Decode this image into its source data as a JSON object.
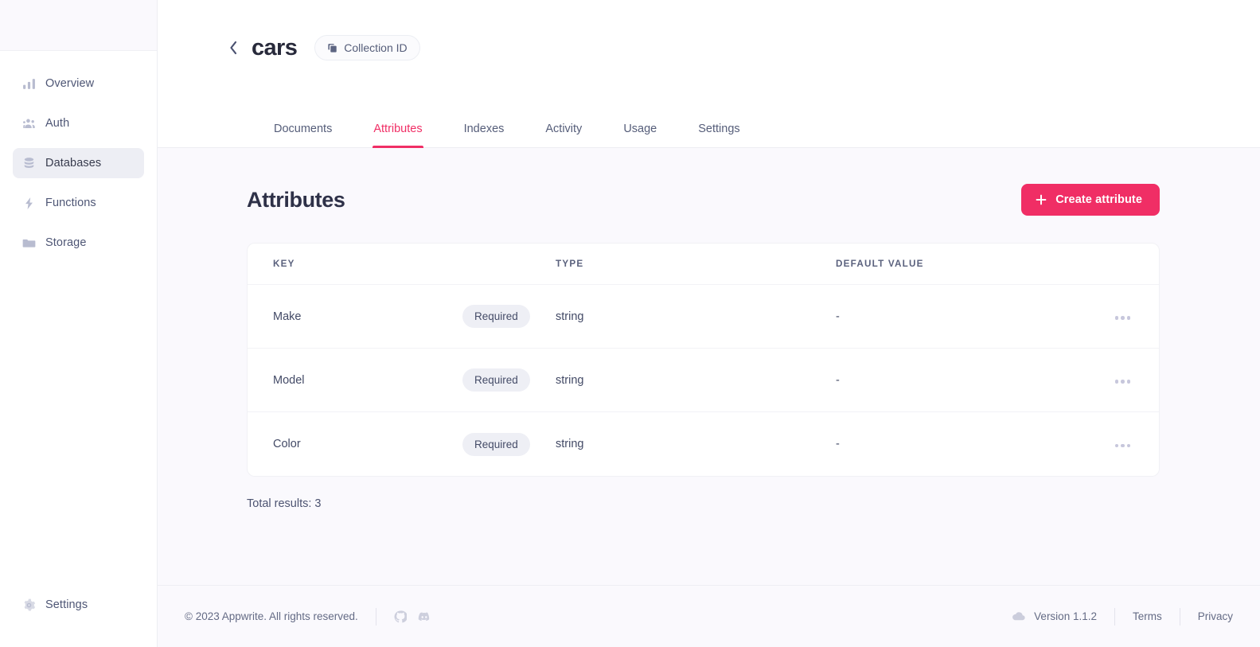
{
  "sidebar": {
    "items": [
      {
        "label": "Overview",
        "icon": "bar-chart-icon",
        "active": false
      },
      {
        "label": "Auth",
        "icon": "users-icon",
        "active": false
      },
      {
        "label": "Databases",
        "icon": "database-icon",
        "active": true
      },
      {
        "label": "Functions",
        "icon": "lightning-bolt-icon",
        "active": false
      },
      {
        "label": "Storage",
        "icon": "folder-icon",
        "active": false
      }
    ],
    "bottom": {
      "label": "Settings",
      "icon": "gear-icon"
    }
  },
  "header": {
    "back_icon": "chevron-left-icon",
    "collection_name": "cars",
    "collection_id_pill": {
      "label": "Collection ID",
      "icon": "copy-icon"
    },
    "tabs": [
      {
        "label": "Documents",
        "active": false
      },
      {
        "label": "Attributes",
        "active": true
      },
      {
        "label": "Indexes",
        "active": false
      },
      {
        "label": "Activity",
        "active": false
      },
      {
        "label": "Usage",
        "active": false
      },
      {
        "label": "Settings",
        "active": false
      }
    ]
  },
  "main": {
    "page_title": "Attributes",
    "create_button": {
      "label": "Create attribute",
      "icon": "plus-icon"
    },
    "table": {
      "columns": [
        "KEY",
        "",
        "TYPE",
        "DEFAULT VALUE",
        ""
      ],
      "rows": [
        {
          "key": "Make",
          "badge": "Required",
          "type": "string",
          "default": "-",
          "menu_icon": "more-horizontal-icon"
        },
        {
          "key": "Model",
          "badge": "Required",
          "type": "string",
          "default": "-",
          "menu_icon": "more-horizontal-icon"
        },
        {
          "key": "Color",
          "badge": "Required",
          "type": "string",
          "default": "-",
          "menu_icon": "more-horizontal-icon"
        }
      ]
    },
    "total_results": "Total results: 3"
  },
  "footer": {
    "copyright": "© 2023 Appwrite. All rights reserved.",
    "github_icon": "github-icon",
    "discord_icon": "discord-icon",
    "version": "Version 1.1.2",
    "version_icon": "cloud-icon",
    "terms": "Terms",
    "privacy": "Privacy"
  },
  "colors": {
    "accent": "#f02e65",
    "background": "#faf9fd",
    "card": "#ffffff",
    "text": "#434a66",
    "badge_bg": "#eeeff5"
  }
}
